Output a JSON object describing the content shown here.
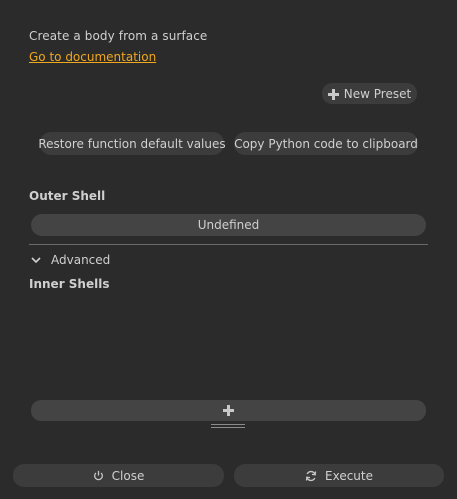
{
  "header": {
    "description": "Create a body from a surface",
    "doc_link": "Go to documentation"
  },
  "presets": {
    "new_preset_label": "New Preset",
    "new_preset_icon": "plus-icon"
  },
  "actions": {
    "restore_label": "Restore function default values",
    "copy_label": "Copy Python code to clipboard"
  },
  "outer_shell": {
    "label": "Outer Shell",
    "value": "Undefined"
  },
  "advanced": {
    "label": "Advanced",
    "icon": "chevron-down-icon"
  },
  "inner_shells": {
    "label": "Inner Shells",
    "add_icon": "plus-icon"
  },
  "footer": {
    "close_label": "Close",
    "close_icon": "power-icon",
    "execute_label": "Execute",
    "execute_icon": "refresh-icon"
  },
  "colors": {
    "background": "#2b2b2b",
    "button": "#3c3c3c",
    "field": "#444444",
    "link": "#f0a81e",
    "text": "#d0d0d0"
  }
}
